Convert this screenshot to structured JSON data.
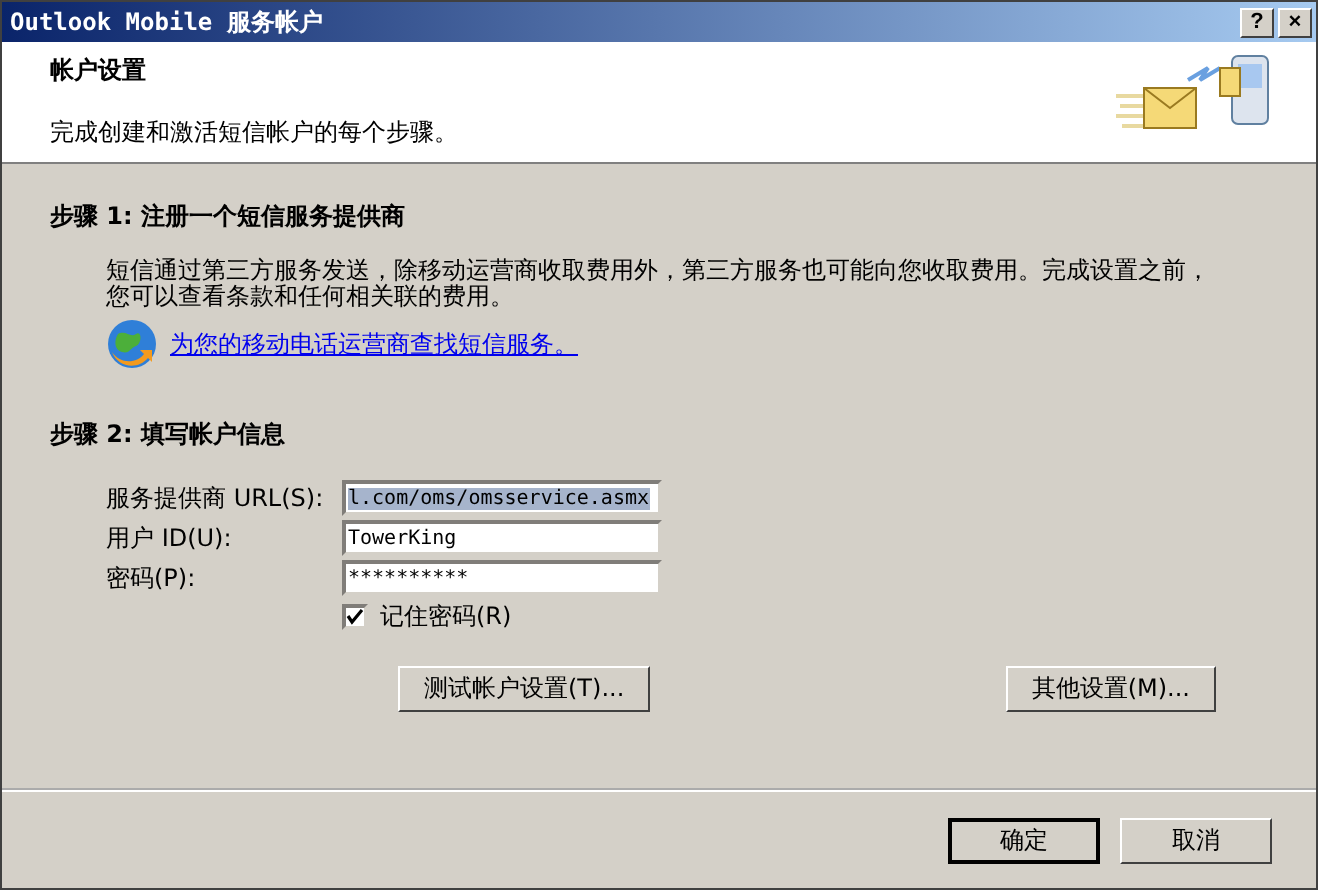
{
  "window": {
    "title": "Outlook Mobile 服务帐户",
    "buttons": [
      "?",
      "×"
    ]
  },
  "header": {
    "title": "帐户设置",
    "subtitle": "完成创建和激活短信帐户的每个步骤。"
  },
  "step1": {
    "heading": "步骤 1: 注册一个短信服务提供商",
    "description": "短信通过第三方服务发送，除移动运营商收取费用外，第三方服务也可能向您收取费用。完成设置之前，您可以查看条款和任何相关联的费用。",
    "link": "为您的移动电话运营商查找短信服务。"
  },
  "step2": {
    "heading": "步骤 2: 填写帐户信息",
    "fields": [
      {
        "label": "服务提供商 URL(S):",
        "value": "l.com/oms/omsservice.asmx",
        "selected": true
      },
      {
        "label": "用户 ID(U):",
        "value": "TowerKing",
        "selected": false
      },
      {
        "label": "密码(P):",
        "value": "**********",
        "selected": false
      }
    ],
    "remember": {
      "label": "记住密码(R)",
      "checked": true
    },
    "buttons": [
      "测试帐户设置(T)...",
      "其他设置(M)..."
    ]
  },
  "footer": {
    "buttons": [
      {
        "label": "确定",
        "selected": true
      },
      {
        "label": "取消",
        "selected": false
      }
    ]
  }
}
